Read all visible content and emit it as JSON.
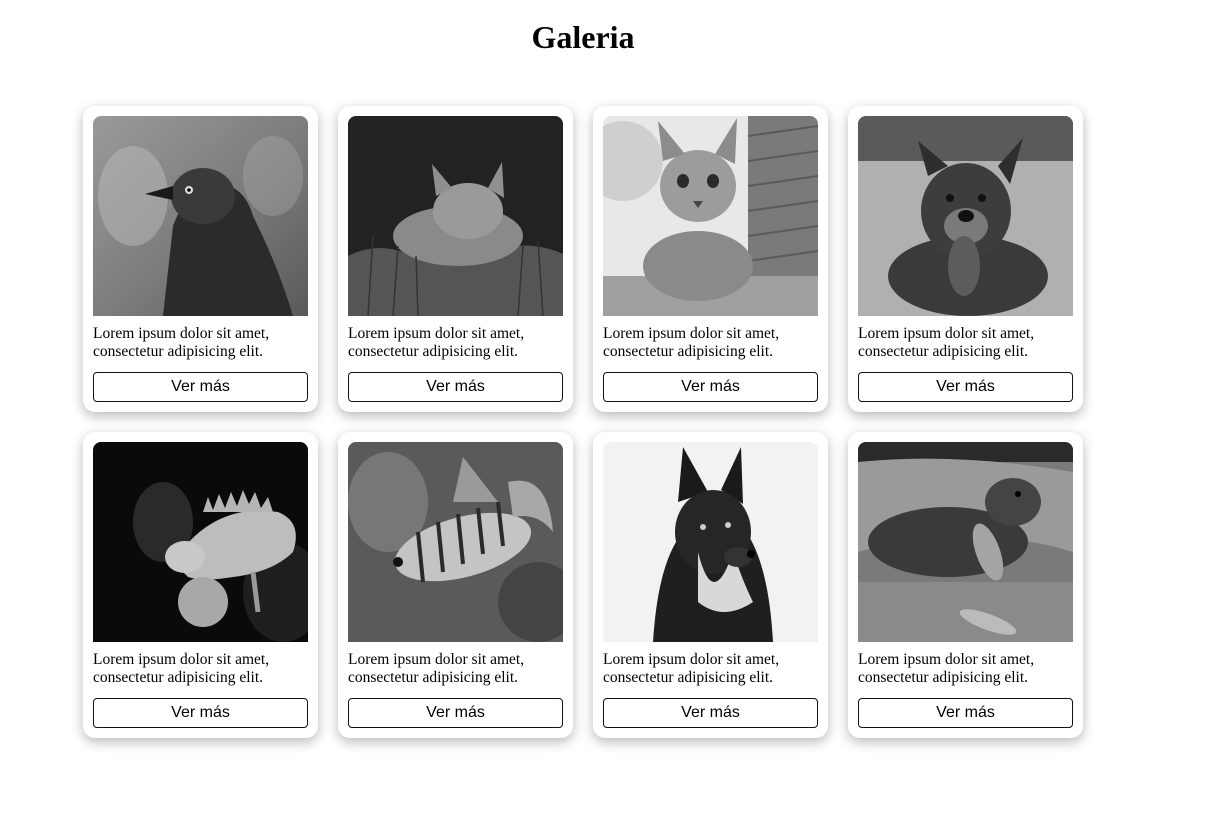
{
  "page": {
    "title": "Galeria"
  },
  "cards": [
    {
      "image_subject": "jackdaw bird",
      "description": "Lorem ipsum dolor sit amet, consectetur adipisicing elit.",
      "button_label": "Ver más"
    },
    {
      "image_subject": "cat in grass",
      "description": "Lorem ipsum dolor sit amet, consectetur adipisicing elit.",
      "button_label": "Ver más"
    },
    {
      "image_subject": "bengal cat",
      "description": "Lorem ipsum dolor sit amet, consectetur adipisicing elit.",
      "button_label": "Ver más"
    },
    {
      "image_subject": "dog with toy",
      "description": "Lorem ipsum dolor sit amet, consectetur adipisicing elit.",
      "button_label": "Ver más"
    },
    {
      "image_subject": "iguana",
      "description": "Lorem ipsum dolor sit amet, consectetur adipisicing elit.",
      "button_label": "Ver más"
    },
    {
      "image_subject": "lionfish",
      "description": "Lorem ipsum dolor sit amet, consectetur adipisicing elit.",
      "button_label": "Ver más"
    },
    {
      "image_subject": "shepherd dog",
      "description": "Lorem ipsum dolor sit amet, consectetur adipisicing elit.",
      "button_label": "Ver más"
    },
    {
      "image_subject": "otter",
      "description": "Lorem ipsum dolor sit amet, consectetur adipisicing elit.",
      "button_label": "Ver más"
    }
  ]
}
